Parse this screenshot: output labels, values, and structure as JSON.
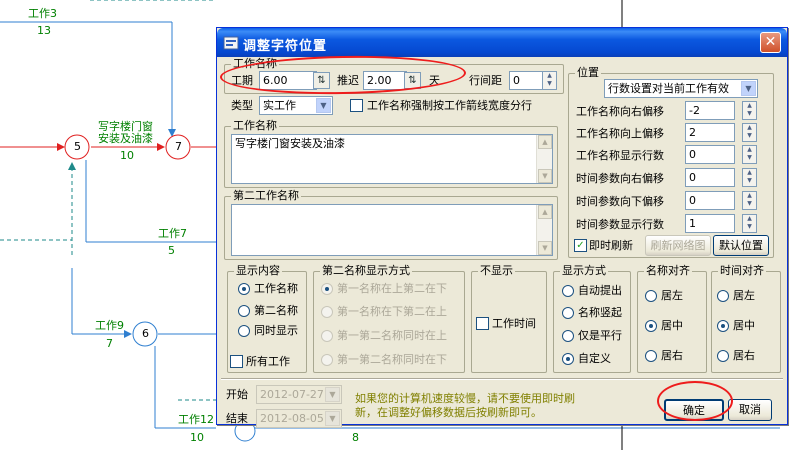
{
  "background": {
    "labels": {
      "work3": "工作3",
      "n13": "13",
      "work_name_line1": "写字楼门窗",
      "work_name_line2": "安装及油漆",
      "n10a": "10",
      "node5": "5",
      "node7": "7",
      "node6": "6",
      "work7": "工作7",
      "n5": "5",
      "work9": "工作9",
      "n7": "7",
      "work12": "工作12",
      "n10b": "10",
      "n8": "8"
    }
  },
  "dialog": {
    "title": "调整字符位置",
    "close_label": "✕",
    "work_name_group": "工作名称",
    "duration_label": "工期",
    "duration_value": "6.00",
    "delay_label": "推迟",
    "delay_value": "2.00",
    "day_unit": "天",
    "row_gap_label": "行间距",
    "row_gap_value": "0",
    "type_label": "类型",
    "type_value": "实工作",
    "force_split_label": "工作名称强制按工作箭线宽度分行",
    "work_name_box_label": "工作名称",
    "work_name_text": "写字楼门窗安装及油漆",
    "second_name_label": "第二工作名称",
    "second_name_text": "",
    "position": {
      "group_title": "位置",
      "scope_value": "行数设置对当前工作有效",
      "rows": [
        {
          "label": "工作名称向右偏移",
          "value": "-2"
        },
        {
          "label": "工作名称向上偏移",
          "value": "2"
        },
        {
          "label": "工作名称显示行数",
          "value": "0"
        },
        {
          "label": "时间参数向右偏移",
          "value": "0"
        },
        {
          "label": "时间参数向下偏移",
          "value": "0"
        },
        {
          "label": "时间参数显示行数",
          "value": "1"
        }
      ],
      "instant_refresh_label": "即时刷新",
      "refresh_diagram_label": "刷新网络图",
      "default_position_label": "默认位置"
    },
    "display_content": {
      "title": "显示内容",
      "options": [
        "工作名称",
        "第二名称",
        "同时显示"
      ],
      "all_work_label": "所有工作"
    },
    "second_name_mode": {
      "title": "第二名称显示方式",
      "options": [
        "第一名称在上第二在下",
        "第一名称在下第二在上",
        "第一第二名称同时在上",
        "第一第二名称同时在下"
      ]
    },
    "hide": {
      "title": "不显示",
      "work_time_label": "工作时间"
    },
    "display_mode": {
      "title": "显示方式",
      "options": [
        "自动提出",
        "名称竖起",
        "仅是平行",
        "自定义"
      ]
    },
    "name_align": {
      "title": "名称对齐",
      "options": [
        "居左",
        "居中",
        "居右"
      ]
    },
    "time_align": {
      "title": "时间对齐",
      "options": [
        "居左",
        "居中",
        "居右"
      ]
    },
    "start_label": "开始",
    "start_value": "2012-07-27",
    "end_label": "结束",
    "end_value": "2012-08-05",
    "note_line1": "如果您的计算机速度较慢，请不要使用即时刷",
    "note_line2": "新，在调整好偏移数据后按刷新即可。",
    "ok_label": "确定",
    "cancel_label": "取消"
  },
  "colors": {
    "arrow_blue": "#2f7fd0",
    "arrow_red": "#e02020",
    "dashed_teal": "#1e8a8a",
    "label_green": "#008000",
    "annotation_red": "#ee1c1c",
    "title_bar": "#0b58e0"
  }
}
